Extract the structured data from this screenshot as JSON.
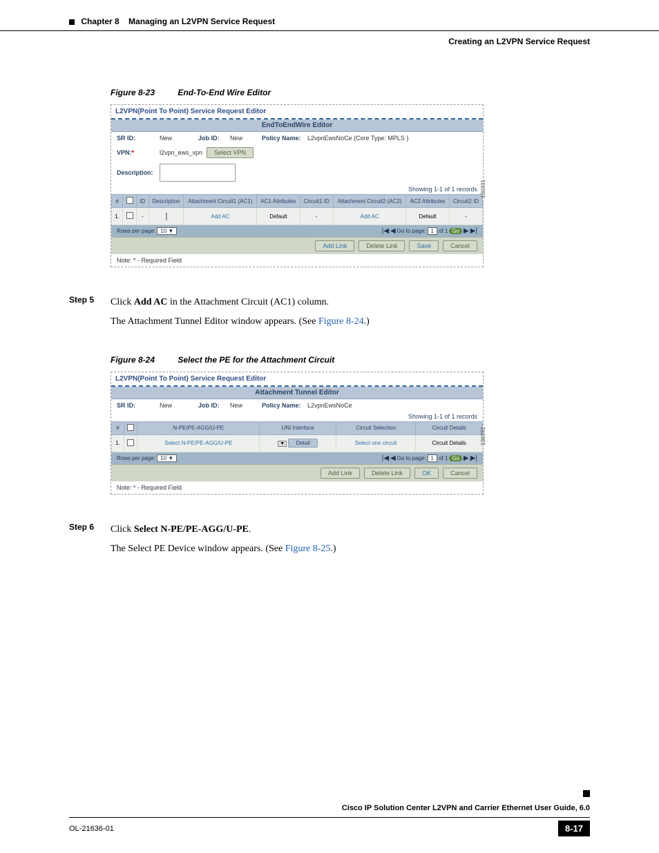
{
  "header": {
    "chapter": "Chapter 8",
    "chapter_title": "Managing an L2VPN Service Request",
    "section_title": "Creating an L2VPN Service Request"
  },
  "figure1": {
    "num": "Figure 8-23",
    "title": "End-To-End Wire Editor",
    "editor_title": "L2VPN(Point To Point) Service Request Editor",
    "panel_title": "EndToEndWire Editor",
    "sr_id_lbl": "SR ID:",
    "sr_id_val": "New",
    "job_id_lbl": "Job ID:",
    "job_id_val": "New",
    "policy_lbl": "Policy Name:",
    "policy_val": "L2vpnEwsNoCe (Core Type: MPLS )",
    "vpn_lbl": "VPN:",
    "vpn_val": "l2vpn_ews_vpn",
    "select_vpn": "Select VPN",
    "desc_lbl": "Description:",
    "records": "Showing 1-1 of 1 records",
    "cols": {
      "hash": "#",
      "id": "ID",
      "desc": "Description",
      "ac1": "Attachment Circuit1 (AC1)",
      "ac1attr": "AC1 Attributes",
      "c1id": "Circuit1 ID",
      "ac2": "Attachment Circuit2 (AC2)",
      "ac2attr": "AC2 Attributes",
      "c2id": "Circuit2 ID"
    },
    "row": {
      "num": "1.",
      "addac": "Add AC",
      "default": "Default",
      "dash": "-"
    },
    "pager": {
      "rows_lbl": "Rows per page:",
      "rows_val": "10",
      "goto_lbl": "Go to page:",
      "goto_val": "1",
      "of": "of 1",
      "go": "Go"
    },
    "buttons": {
      "add": "Add Link",
      "del": "Delete Link",
      "save": "Save",
      "cancel": "Cancel"
    },
    "note": "Note: * - Required Field",
    "img_id": "130391"
  },
  "step5": {
    "label": "Step 5",
    "line1a": "Click ",
    "line1b": "Add AC",
    "line1c": " in the Attachment Circuit (AC1) column.",
    "line2a": "The Attachment Tunnel Editor window appears. (See ",
    "line2b": "Figure 8-24",
    "line2c": ".)"
  },
  "figure2": {
    "num": "Figure 8-24",
    "title": "Select the PE for the Attachment Circuit",
    "editor_title": "L2VPN(Point To Point) Service Request Editor",
    "panel_title": "Attachment Tunnel Editor",
    "sr_id_lbl": "SR ID:",
    "sr_id_val": "New",
    "job_id_lbl": "Job ID:",
    "job_id_val": "New",
    "policy_lbl": "Policy Name:",
    "policy_val": "L2vpnEwsNoCe",
    "records": "Showing 1-1 of 1 records",
    "cols": {
      "hash": "#",
      "npe": "N-PE/PE-AGG/U-PE",
      "uni": "UNI Interface",
      "csel": "Circuit Selection",
      "cdet": "Circuit Details"
    },
    "row": {
      "num": "1.",
      "select_npe": "Select N-PE/PE-AGG/U-PE",
      "detail": "Detail",
      "sel_one": "Select one circuit",
      "cd": "Circuit Details"
    },
    "pager": {
      "rows_lbl": "Rows per page:",
      "rows_val": "10",
      "goto_lbl": "Go to page:",
      "goto_val": "1",
      "of": "of 1",
      "go": "Go"
    },
    "buttons": {
      "add": "Add Link",
      "del": "Delete Link",
      "ok": "OK",
      "cancel": "Cancel"
    },
    "note": "Note: * - Required Field",
    "img_id": "130392"
  },
  "step6": {
    "label": "Step 6",
    "line1a": "Click ",
    "line1b": "Select N-PE/PE-AGG/U-PE",
    "line1c": ".",
    "line2a": "The Select PE Device window appears. (See ",
    "line2b": "Figure 8-25",
    "line2c": ".)"
  },
  "footer": {
    "guide": "Cisco IP Solution Center L2VPN and Carrier Ethernet User Guide, 6.0",
    "doc": "OL-21636-01",
    "page": "8-17"
  }
}
